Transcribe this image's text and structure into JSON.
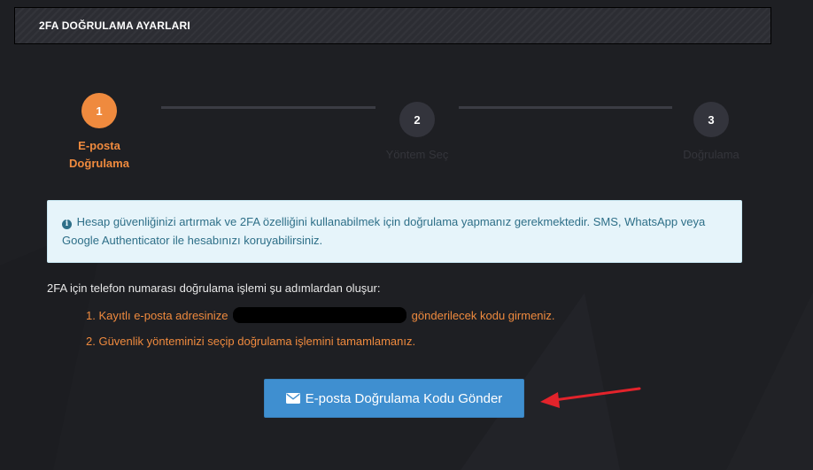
{
  "header": {
    "title": "2FA DOĞRULAMA AYARLARI"
  },
  "stepper": {
    "steps": [
      {
        "number": "1",
        "label": "E-posta Doğrulama",
        "active": true
      },
      {
        "number": "2",
        "label": "Yöntem Seç",
        "active": false
      },
      {
        "number": "3",
        "label": "Doğrulama",
        "active": false
      }
    ]
  },
  "info": {
    "icon": "info-circle-icon",
    "text": "Hesap güvenliğinizi artırmak ve 2FA özelliğini kullanabilmek için doğrulama yapmanız gerekmektedir. SMS, WhatsApp veya Google Authenticator ile hesabınızı koruyabilirsiniz."
  },
  "instructions": {
    "intro": "2FA için telefon numarası doğrulama işlemi şu adımlardan oluşur:",
    "step1_before": "1. Kayıtlı e-posta adresinize",
    "step1_after": "gönderilecek kodu girmeniz.",
    "step2": "2. Güvenlik yönteminizi seçip doğrulama işlemini tamamlamanız."
  },
  "action": {
    "icon": "envelope-icon",
    "send_label": "E-posta Doğrulama Kodu Gönder"
  },
  "colors": {
    "accent": "#ef8a3e",
    "button": "#3f8fd0",
    "info_bg": "#e6f4fa",
    "info_text": "#2e6f88",
    "annotation_arrow": "#e3232b"
  }
}
